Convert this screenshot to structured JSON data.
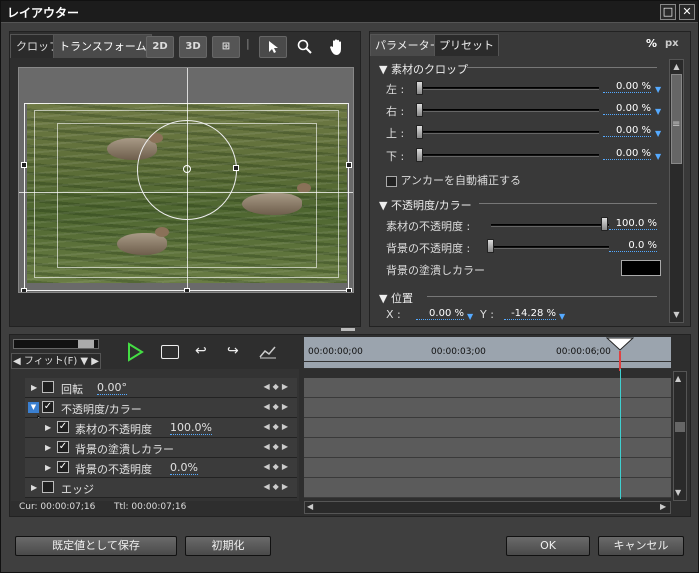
{
  "window": {
    "title": "レイアウター"
  },
  "preview": {
    "tabs": [
      "クロップ",
      "トランスフォーム"
    ],
    "toolbar": {
      "mode2d": "2D",
      "mode3d": "3D",
      "separator": "|"
    }
  },
  "params": {
    "tabs": [
      "パラメーター",
      "プリセット"
    ],
    "unit_percent": "%",
    "unit_px": "px",
    "crop": {
      "title": "素材のクロップ",
      "rows": [
        {
          "label": "左 :",
          "value": "0.00 %"
        },
        {
          "label": "右 :",
          "value": "0.00 %"
        },
        {
          "label": "上 :",
          "value": "0.00 %"
        },
        {
          "label": "下 :",
          "value": "0.00 %"
        }
      ],
      "anchor_label": "アンカーを自動補正する"
    },
    "opacity": {
      "title": "不透明度/カラー",
      "material_label": "素材の不透明度 :",
      "material_value": "100.0 %",
      "background_label": "背景の不透明度 :",
      "background_value": "0.0 %",
      "fill_label": "背景の塗潰しカラー",
      "fill_color": "#000000"
    },
    "position": {
      "title": "位置",
      "x_label": "X :",
      "x_value": "0.00 %",
      "y_label": "Y :",
      "y_value": "-14.28 %"
    }
  },
  "timeline": {
    "fit_label": "◀ フィット(F) ▼ ▶",
    "ruler": [
      "00:00:00;00",
      "00:00:03;00",
      "00:00:06;00"
    ],
    "tracks": [
      {
        "label": "回転",
        "value": "0.00°",
        "checked": false
      },
      {
        "label": "不透明度/カラー",
        "value": "",
        "checked": true
      },
      {
        "label": "素材の不透明度",
        "value": "100.0%",
        "checked": true
      },
      {
        "label": "背景の塗潰しカラー",
        "value": "",
        "checked": true
      },
      {
        "label": "背景の不透明度",
        "value": "0.0%",
        "checked": true
      },
      {
        "label": "エッジ",
        "value": "",
        "checked": false
      }
    ],
    "cur": "Cur: 00:00:07;16",
    "ttl": "Ttl: 00:00:07;16"
  },
  "buttons": {
    "save_default": "既定値として保存",
    "reset": "初期化",
    "ok": "OK",
    "cancel": "キャンセル"
  },
  "colors": {
    "accent": "#55aaff",
    "play": "#44dd44"
  }
}
